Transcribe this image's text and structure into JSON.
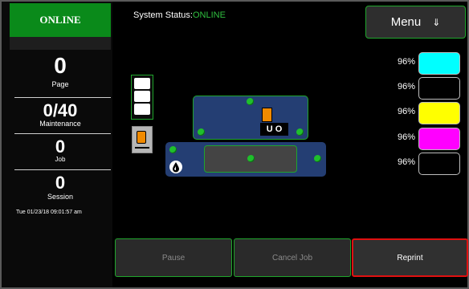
{
  "sidebar": {
    "status": "ONLINE",
    "counters": {
      "page": {
        "value": "0",
        "label": "Page"
      },
      "maintenance": {
        "value": "0/40",
        "label": "Maintenance"
      },
      "job": {
        "value": "0",
        "label": "Job"
      },
      "session": {
        "value": "0",
        "label": "Session"
      }
    },
    "timestamp": "Tue 01/23/18 09:01:57 am"
  },
  "header": {
    "system_status_label": "System Status:",
    "system_status_value": "ONLINE",
    "menu_label": "Menu",
    "menu_arrow": "⇓"
  },
  "printhead": {
    "status_symbols": "U O"
  },
  "ink": [
    {
      "name": "cyan",
      "level": "96%",
      "color": "#00ffff"
    },
    {
      "name": "black",
      "level": "96%",
      "color": "#000000"
    },
    {
      "name": "yellow",
      "level": "96%",
      "color": "#ffff00"
    },
    {
      "name": "magenta",
      "level": "96%",
      "color": "#ff00ff"
    },
    {
      "name": "black-2",
      "level": "96%",
      "color": "#000000"
    }
  ],
  "actions": {
    "pause": "Pause",
    "cancel": "Cancel Job",
    "reprint": "Reprint"
  },
  "colors": {
    "online_green": "#0a8a1a",
    "accent_green": "#1fa52c",
    "alert_red": "#e01010",
    "unit_blue": "#243e73"
  }
}
